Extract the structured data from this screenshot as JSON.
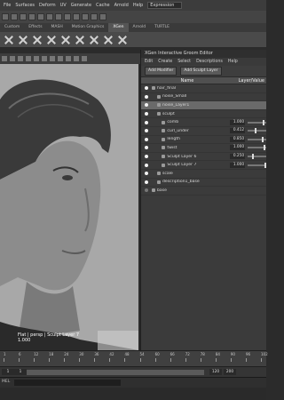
{
  "menubar": {
    "items": [
      "File",
      "Surfaces",
      "Deform",
      "UV",
      "Generate",
      "Cache",
      "Arnold",
      "Help"
    ],
    "workspace_select": "Expression"
  },
  "shelf_tabs": [
    "Custom",
    "Effects",
    "MASH",
    "Motion Graphics",
    "XGen",
    "Arnold",
    "TURTLE"
  ],
  "shelf_tools_count": 9,
  "panel": {
    "title": "XGen Interactive Groom Editor",
    "menu": [
      "Edit",
      "Create",
      "Select",
      "Descriptions",
      "Help"
    ],
    "tools": {
      "add_modifier": "Add Modifier",
      "add_sculpt_layer": "Add Sculpt Layer"
    },
    "columns": {
      "name": "Name",
      "value": "Layer/Value"
    },
    "rows": [
      {
        "name": "hair_final",
        "visible": true,
        "indent": 0
      },
      {
        "name": "noise_Small",
        "visible": true,
        "indent": 1
      },
      {
        "name": "noise_Layer1",
        "visible": true,
        "indent": 1,
        "selected": true
      },
      {
        "name": "sculpt",
        "visible": true,
        "indent": 1
      },
      {
        "name": "comb",
        "visible": true,
        "indent": 2,
        "value": "1.000",
        "slider": 0.85
      },
      {
        "name": "curl_under",
        "visible": true,
        "indent": 2,
        "value": "0.412",
        "slider": 0.4
      },
      {
        "name": "length",
        "visible": true,
        "indent": 2,
        "value": "0.850",
        "slider": 0.8
      },
      {
        "name": "twist",
        "visible": true,
        "indent": 2,
        "value": "1.000",
        "slider": 0.9
      },
      {
        "name": "Sculpt Layer 6",
        "visible": true,
        "indent": 2,
        "value": "0.250",
        "slider": 0.25
      },
      {
        "name": "Sculpt Layer 7",
        "visible": true,
        "indent": 2,
        "value": "1.000",
        "slider": 0.95
      },
      {
        "name": "scale",
        "visible": true,
        "indent": 1
      },
      {
        "name": "description1_base",
        "visible": true,
        "indent": 1
      },
      {
        "name": "base",
        "visible": false,
        "indent": 0
      }
    ]
  },
  "viewport": {
    "hud_line1": "Flat | persp | Sculpt Layer 7",
    "hud_line2": "1.000"
  },
  "timeline": {
    "ticks": [
      "1",
      "6",
      "12",
      "18",
      "24",
      "30",
      "36",
      "42",
      "48",
      "54",
      "60",
      "66",
      "72",
      "78",
      "84",
      "90",
      "96",
      "102"
    ],
    "current_frame": "1"
  },
  "range": {
    "start": "1",
    "end": "120",
    "range_start": "1",
    "range_end": "200"
  },
  "cmdline": {
    "language": "MEL"
  },
  "colors": {
    "ui_bg": "#2b2b2b",
    "panel": "#3b3b3b",
    "viewport_bg": "#a7a7a7",
    "selected_row": "#5a5a5a"
  }
}
